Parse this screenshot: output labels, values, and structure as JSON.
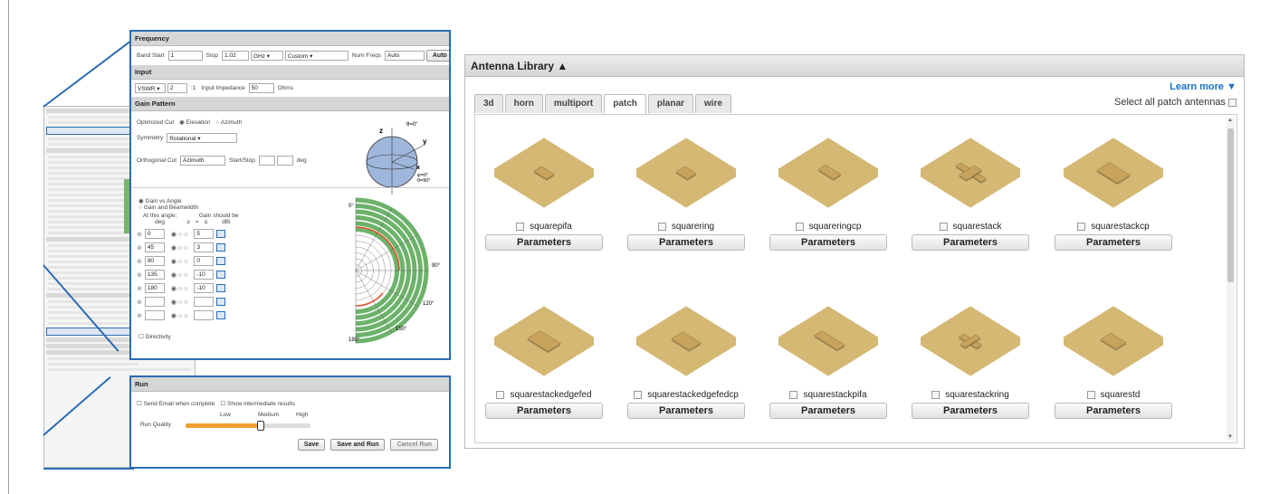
{
  "frequency": {
    "header": "Frequency",
    "band_start_label": "Band Start",
    "band_start": "1",
    "stop_label": "Stop",
    "stop": "1.02",
    "unit": "GHz",
    "preset": "Custom",
    "num_freqs_label": "Num Freqs",
    "num_freqs": "Auto",
    "auto_button": "Auto"
  },
  "input": {
    "header": "Input",
    "type": "VSWR",
    "value": "2",
    "ratio": ":1",
    "impedance_label": "Input Impedance",
    "impedance": "50",
    "impedance_unit": "Ohms"
  },
  "gain": {
    "header": "Gain Pattern",
    "optimized_cut_label": "Optimized Cut",
    "elevation": "Elevation",
    "azimuth": "Azimuth",
    "symmetry_label": "Symmetry",
    "symmetry": "Rotational",
    "orthogonal_label": "Orthogonal Cut",
    "orthogonal": "Azimuth",
    "start_stop_label": "Start/Stop",
    "deg": "deg",
    "gain_vs_angle": "Gain vs Angle",
    "gain_beamwidth": "Gain and Beamwidth",
    "at_angle": "At this angle:",
    "at_angle_unit": "deg",
    "gain_should_be": "Gain should be",
    "gain_unit": "dBi",
    "ops": [
      "≥",
      "=",
      "≤"
    ],
    "rows": [
      {
        "angle": "0",
        "gain": "5"
      },
      {
        "angle": "45",
        "gain": "3"
      },
      {
        "angle": "90",
        "gain": "0"
      },
      {
        "angle": "135",
        "gain": "-10"
      },
      {
        "angle": "180",
        "gain": "-10"
      },
      {
        "angle": "",
        "gain": ""
      },
      {
        "angle": "",
        "gain": ""
      }
    ],
    "directivity": "Directivity",
    "sphere_theta0": "θ=0°",
    "sphere_z": "z",
    "sphere_y": "y",
    "sphere_x": "x",
    "sphere_phi0": "φ=0°",
    "sphere_theta90": "θ=90°",
    "polar_labels": [
      "0°",
      "90°",
      "120°",
      "150°",
      "180°"
    ]
  },
  "run": {
    "header": "Run",
    "send_email": "Send Email when complete",
    "show_intermediate": "Show intermediate results",
    "quality_label": "Run Quality",
    "low": "Low",
    "medium": "Medium",
    "high": "High",
    "quality_level": 0.6,
    "save": "Save",
    "save_run": "Save and Run",
    "cancel_run": "Cancel Run"
  },
  "library": {
    "title": "Antenna Library ▲",
    "learn_more": "Learn more ▼",
    "select_all": "Select all patch antennas",
    "tabs": [
      "3d",
      "horn",
      "multiport",
      "patch",
      "planar",
      "wire"
    ],
    "active_tab": "patch",
    "parameters_label": "Parameters",
    "antennas": [
      "squarepifa",
      "squarering",
      "squareringcp",
      "squarestack",
      "squarestackcp",
      "squarestackedgefed",
      "squarestackedgefedcp",
      "squarestackpifa",
      "squarestackring",
      "squarestd"
    ]
  },
  "colors": {
    "accent": "#2a6cb5",
    "substrate": "#d4b874",
    "patch": "#c7a35c",
    "polar_green": "#6db26a",
    "polar_red": "#e2532d",
    "slider": "#f0a030"
  }
}
